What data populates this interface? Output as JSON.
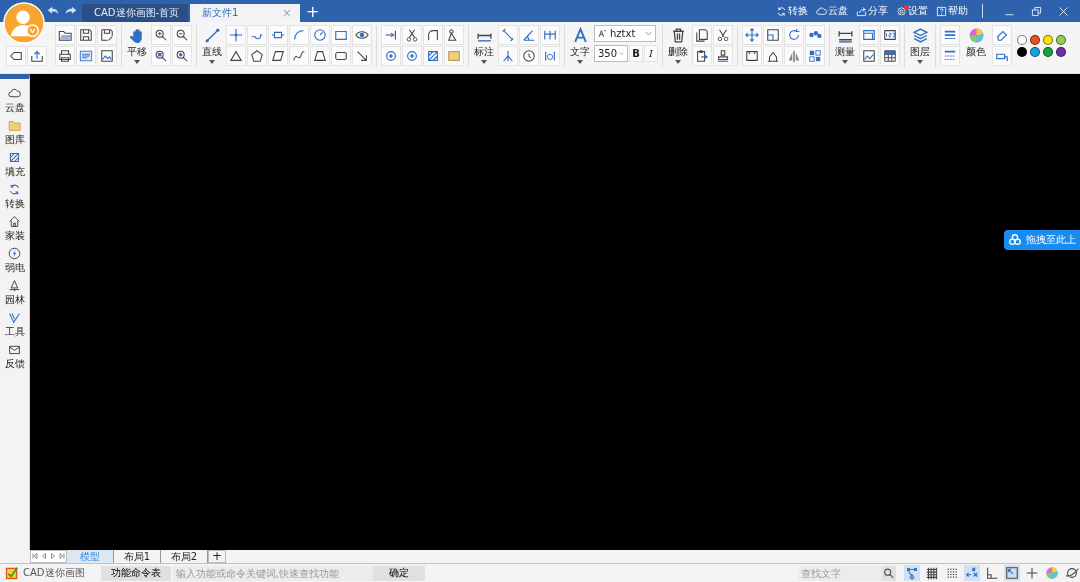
{
  "title_bar": {
    "tabs": [
      {
        "label": "CAD迷你画图-首页",
        "selected": false
      },
      {
        "label": "新文件1",
        "selected": true
      }
    ],
    "close_tab": "×",
    "new_tab": "+",
    "links": [
      {
        "label": "转换"
      },
      {
        "label": "云盘"
      },
      {
        "label": "分享"
      },
      {
        "label": "设置",
        "badge": true
      },
      {
        "label": "帮助"
      }
    ]
  },
  "toolbar": {
    "pan": "平移",
    "line": "直线",
    "dimension": "标注",
    "text": "文字",
    "font": "hztxt",
    "size": "350",
    "bold": "B",
    "italic": "I",
    "delete": "删除",
    "measure": "测量",
    "layer": "图层",
    "color_label": "颜色",
    "swatches": [
      {
        "color": "#ffffff"
      },
      {
        "color": "#e8501e"
      },
      {
        "color": "#f5e600"
      },
      {
        "color": "#8fd14f"
      },
      {
        "color": "#000000"
      },
      {
        "color": "#1ba1e2"
      },
      {
        "color": "#13a538"
      },
      {
        "color": "#7030a0"
      }
    ]
  },
  "sidebar": {
    "items": [
      {
        "label": "云盘"
      },
      {
        "label": "图库"
      },
      {
        "label": "填充"
      },
      {
        "label": "转换"
      },
      {
        "label": "家装"
      },
      {
        "label": "弱电"
      },
      {
        "label": "园林"
      },
      {
        "label": "工具"
      },
      {
        "label": "反馈"
      }
    ]
  },
  "drop_target": {
    "label": "拖拽至此上"
  },
  "layout_tabs": [
    {
      "label": "模型",
      "selected": true
    },
    {
      "label": "布局1",
      "selected": false
    },
    {
      "label": "布局2",
      "selected": false
    }
  ],
  "add_layout": "+",
  "status_bar": {
    "app_name": "CAD迷你画图",
    "command_list": "功能命令表",
    "command_placeholder": "输入功能或命令关键词,快速查找功能",
    "confirm": "确定",
    "search_placeholder": "查找文字",
    "toggles": [
      {
        "on": true
      },
      {
        "on": false
      },
      {
        "on": false
      },
      {
        "on": true
      },
      {
        "on": false
      },
      {
        "on": true
      },
      {
        "on": false
      },
      {
        "on": false
      },
      {
        "on": false
      }
    ]
  }
}
